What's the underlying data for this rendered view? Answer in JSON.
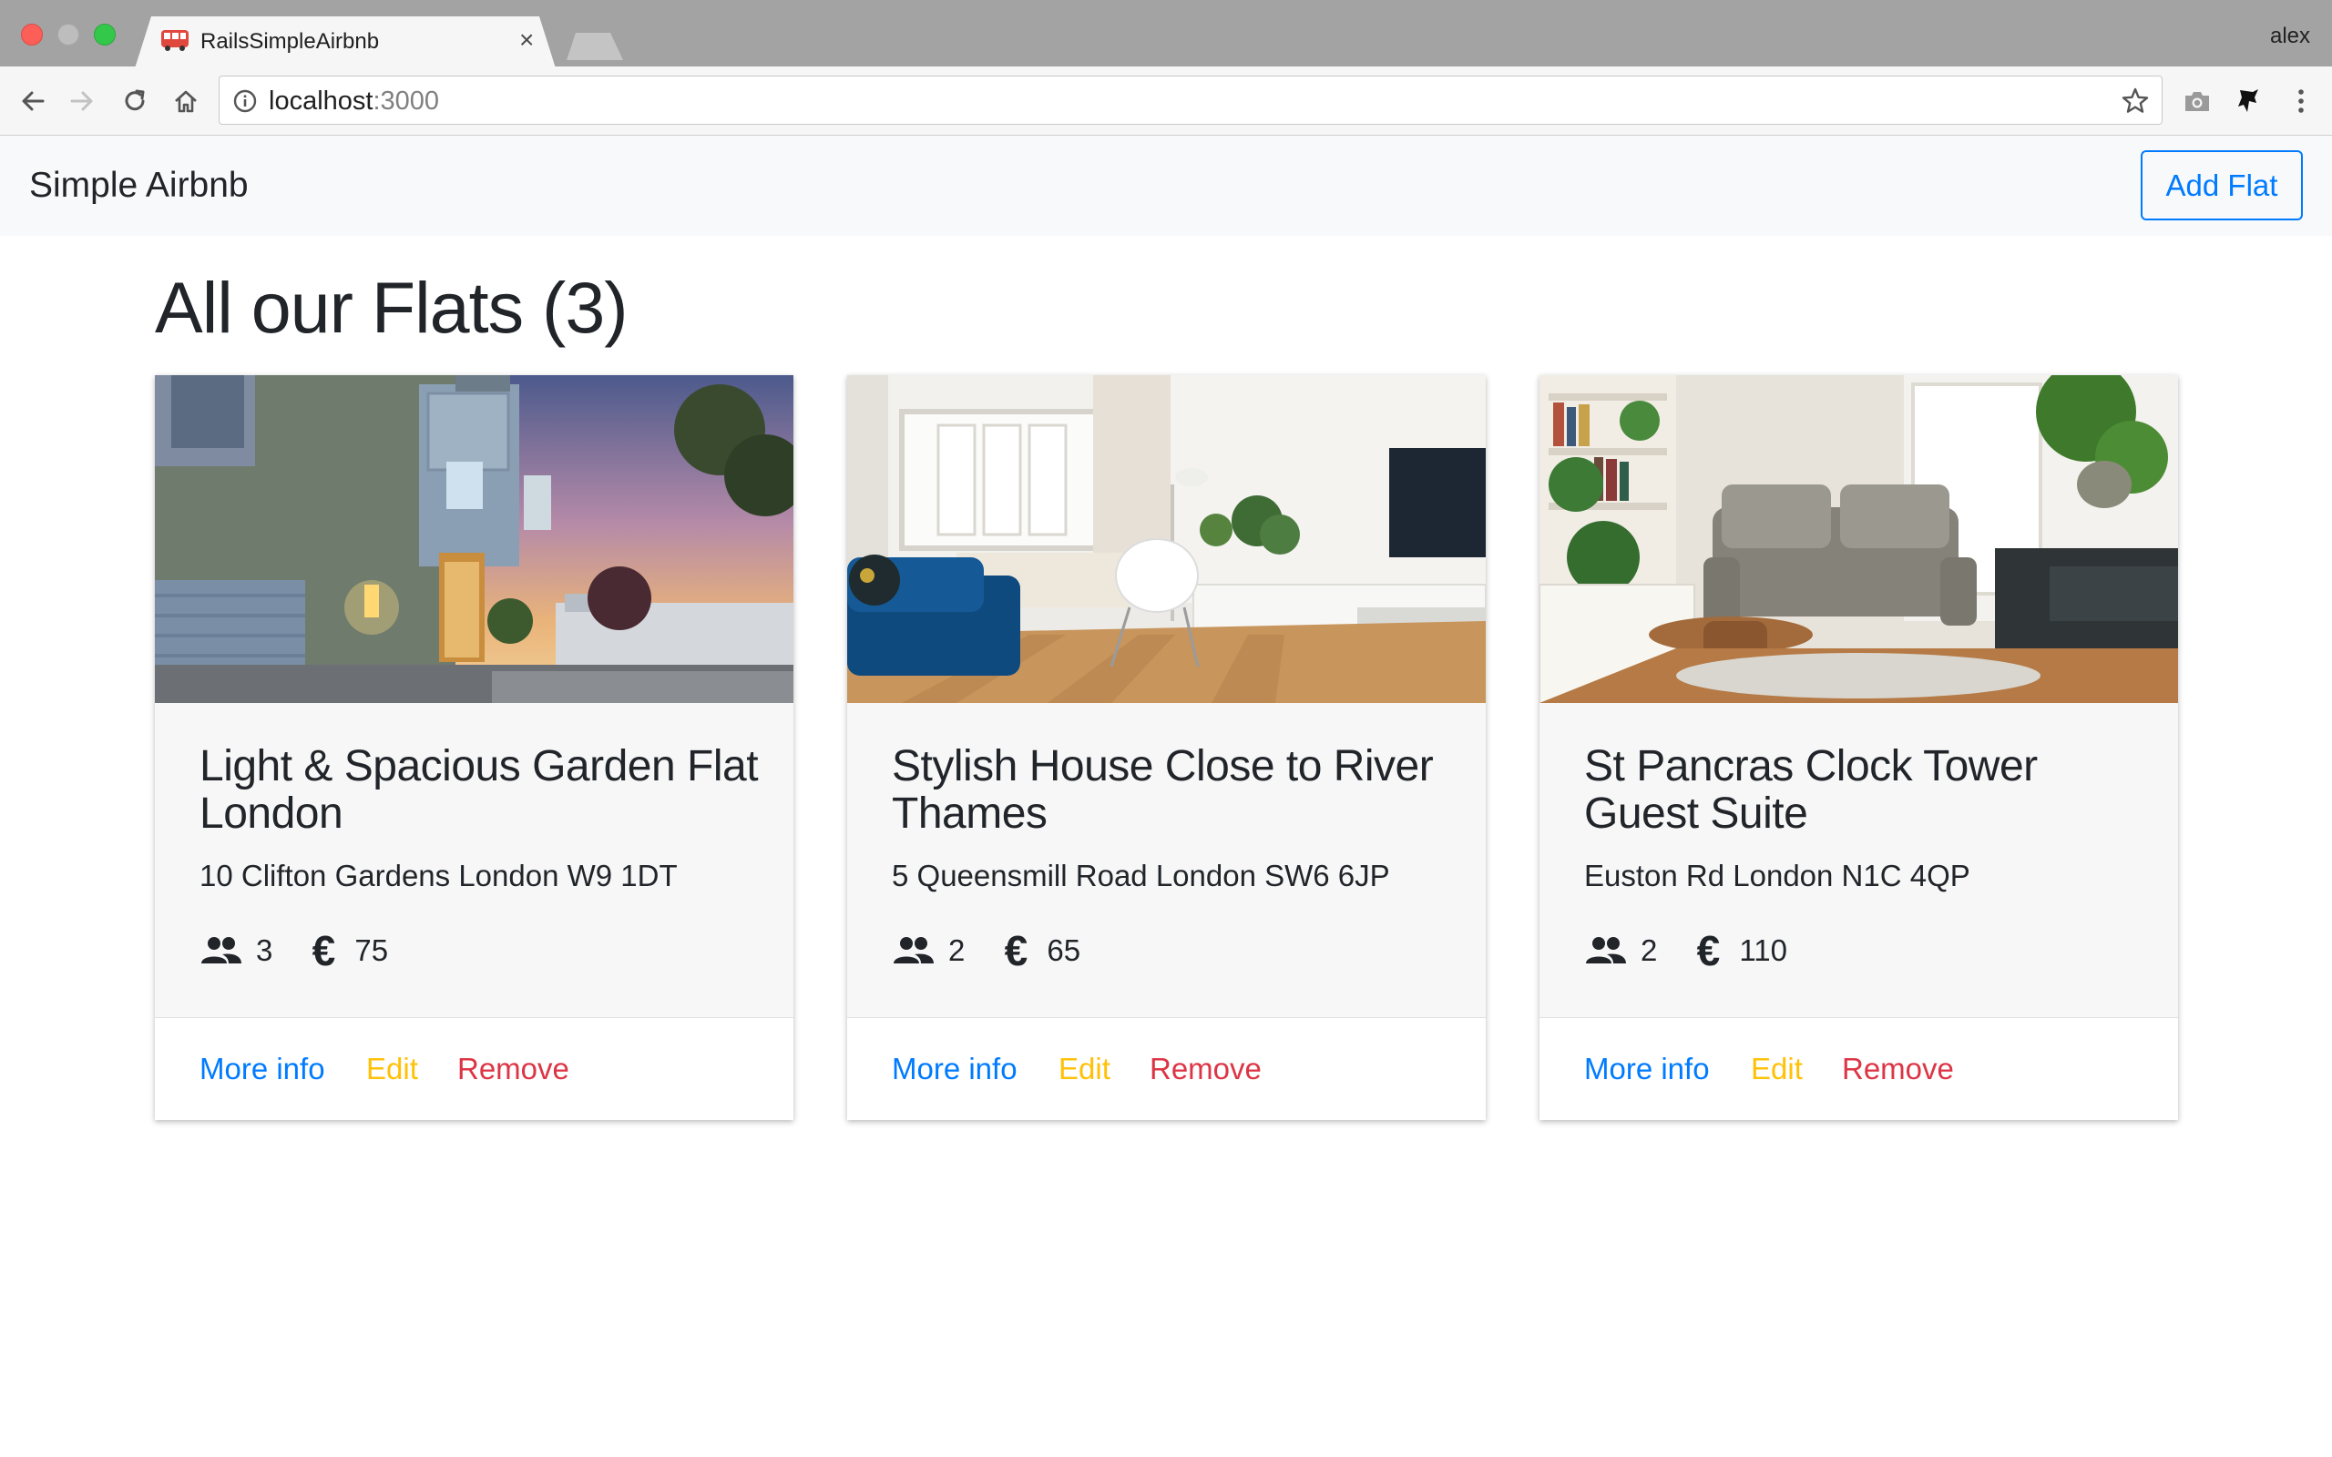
{
  "browser": {
    "tab_title": "RailsSimpleAirbnb",
    "tab_close": "×",
    "profile_name": "alex",
    "url_host": "localhost",
    "url_port": ":3000"
  },
  "navbar": {
    "brand": "Simple Airbnb",
    "add_flat_label": "Add Flat"
  },
  "page": {
    "heading": "All our Flats (3)"
  },
  "colors": {
    "primary": "#007bff",
    "warning": "#ffc107",
    "danger": "#dc3545"
  },
  "flats": [
    {
      "title": "Light & Spacious Garden Flat London",
      "address": "10 Clifton Gardens London W9 1DT",
      "guests": "3",
      "price": "75",
      "more_info": "More info",
      "edit": "Edit",
      "remove": "Remove",
      "image": "house-exterior-dusk"
    },
    {
      "title": "Stylish House Close to River Thames",
      "address": "5 Queensmill Road London SW6 6JP",
      "guests": "2",
      "price": "65",
      "more_info": "More info",
      "edit": "Edit",
      "remove": "Remove",
      "image": "bright-living-room"
    },
    {
      "title": "St Pancras Clock Tower Guest Suite",
      "address": "Euston Rd London N1C 4QP",
      "guests": "2",
      "price": "110",
      "more_info": "More info",
      "edit": "Edit",
      "remove": "Remove",
      "image": "living-room-plants"
    }
  ],
  "icons": {
    "guests": "people-icon",
    "price": "euro-icon",
    "euro_glyph": "€"
  }
}
